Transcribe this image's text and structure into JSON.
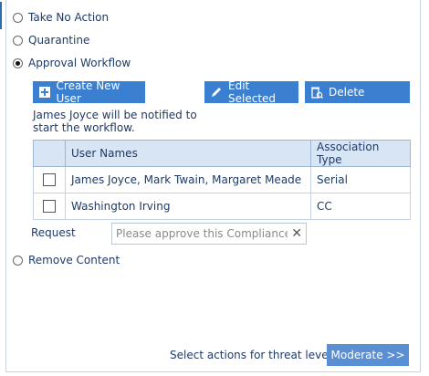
{
  "options": {
    "take_no_action": "Take No Action",
    "quarantine": "Quarantine",
    "approval_workflow": "Approval Workflow",
    "remove_content": "Remove Content",
    "selected": "approval_workflow"
  },
  "toolbar": {
    "create_new_user": "Create New User",
    "edit_selected": "Edit Selected",
    "delete": "Delete"
  },
  "notify_text": "James Joyce will be notified to start the workflow.",
  "table": {
    "headers": [
      "User Names",
      "Association Type"
    ],
    "rows": [
      {
        "user_names": "James Joyce, Mark Twain, Margaret Meade",
        "association_type": "Serial"
      },
      {
        "user_names": "Washington Irving",
        "association_type": "CC"
      }
    ]
  },
  "request": {
    "label": "Request",
    "value": "Please approve this Compliance A"
  },
  "footer": {
    "label": "Select actions for threat level :",
    "button": "Moderate >>"
  },
  "colors": {
    "accent": "#3b7fd0",
    "text": "#1f3a66",
    "header_bg": "#d7e5f5"
  }
}
